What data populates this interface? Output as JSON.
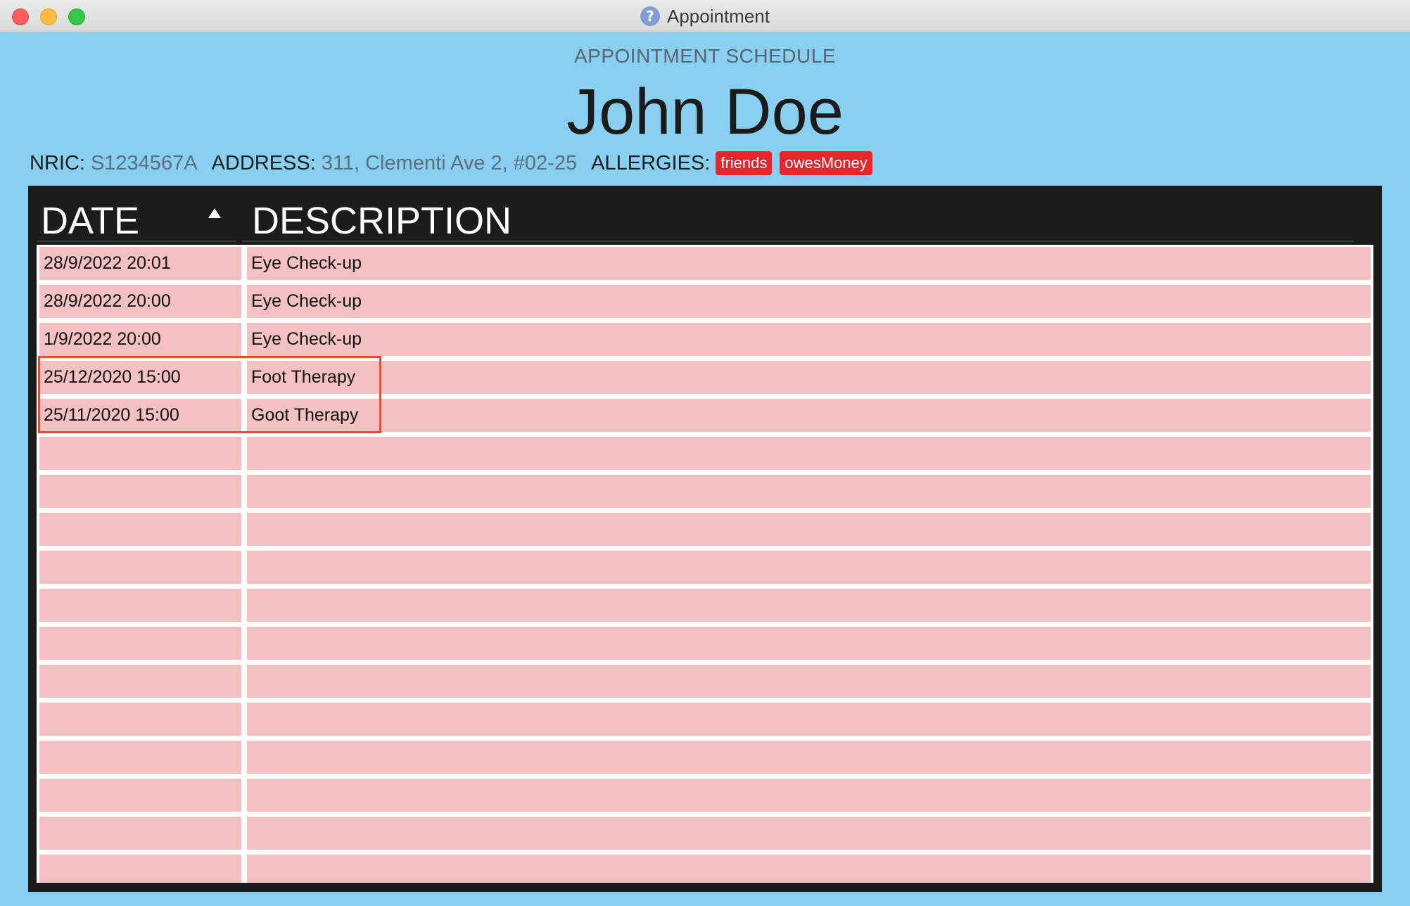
{
  "window": {
    "title": "Appointment",
    "help_icon": "question-mark-icon",
    "help_glyph": "?"
  },
  "header": {
    "section_label": "APPOINTMENT SCHEDULE",
    "patient_name": "John Doe"
  },
  "patient": {
    "nric_label": "NRIC:",
    "nric_value": "S1234567A",
    "address_label": "ADDRESS:",
    "address_value": "311, Clementi Ave 2, #02-25",
    "allergies_label": "ALLERGIES:",
    "allergies": [
      "friends",
      "owesMoney"
    ]
  },
  "table": {
    "columns": [
      "DATE",
      "DESCRIPTION"
    ],
    "sort": {
      "column": "DATE",
      "direction": "ascending"
    },
    "rows": [
      {
        "date": "28/9/2022 20:01",
        "description": "Eye Check-up"
      },
      {
        "date": "28/9/2022 20:00",
        "description": "Eye Check-up"
      },
      {
        "date": "1/9/2022 20:00",
        "description": "Eye Check-up"
      },
      {
        "date": "25/12/2020 15:00",
        "description": "Foot Therapy"
      },
      {
        "date": "25/11/2020 15:00",
        "description": "Goot Therapy"
      }
    ],
    "highlighted_rows": [
      3,
      4
    ],
    "empty_row_count": 12
  },
  "colors": {
    "background": "#88cff0",
    "table_panel": "#1c1c1c",
    "row_fill": "#f4c1c3",
    "tag": "#e8252b",
    "highlight": "#e84a32"
  }
}
